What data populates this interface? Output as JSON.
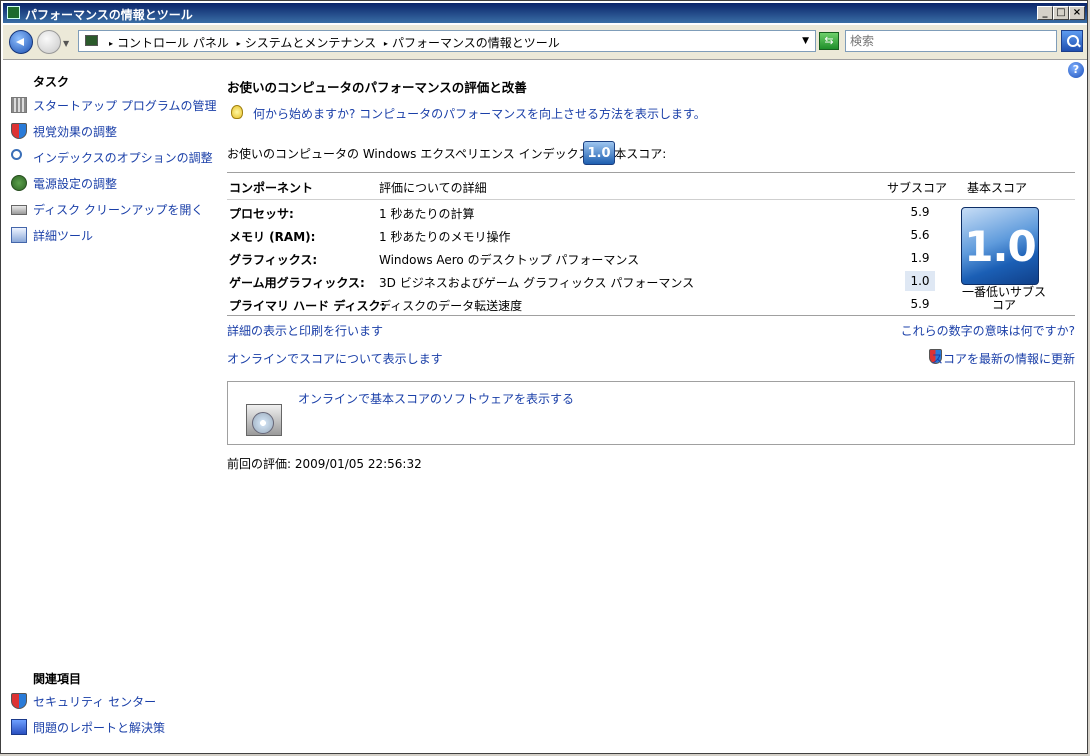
{
  "window": {
    "title": "パフォーマンスの情報とツール"
  },
  "navigation": {
    "breadcrumbs": [
      "コントロール パネル",
      "システムとメンテナンス",
      "パフォーマンスの情報とツール"
    ],
    "search_placeholder": "検索"
  },
  "sidebar": {
    "tasks_heading": "タスク",
    "tasks": [
      {
        "label": "スタートアップ プログラムの管理",
        "icon": "startup-programs-icon"
      },
      {
        "label": "視覚効果の調整",
        "icon": "shield-icon"
      },
      {
        "label": "インデックスのオプションの調整",
        "icon": "indexing-icon"
      },
      {
        "label": "電源設定の調整",
        "icon": "power-icon"
      },
      {
        "label": "ディスク クリーンアップを開く",
        "icon": "disk-cleanup-icon"
      },
      {
        "label": "詳細ツール",
        "icon": "advanced-tools-icon"
      }
    ],
    "related_heading": "関連項目",
    "related": [
      {
        "label": "セキュリティ センター",
        "icon": "shield-icon"
      },
      {
        "label": "問題のレポートと解決策",
        "icon": "problem-reports-icon"
      }
    ]
  },
  "main": {
    "title": "お使いのコンピュータのパフォーマンスの評価と改善",
    "tip_text": "何から始めますか? コンピュータのパフォーマンスを向上させる方法を表示します。",
    "score_line": "お使いのコンピュータの Windows エクスペリエンス インデックスの基本スコア:",
    "base_score": "1.0",
    "table_headers": {
      "component": "コンポーネント",
      "detail": "評価についての詳細",
      "subscore": "サブスコア",
      "basescore": "基本スコア"
    },
    "rows": [
      {
        "component": "プロセッサ:",
        "detail": "1 秒あたりの計算",
        "subscore": "5.9"
      },
      {
        "component": "メモリ (RAM):",
        "detail": "1 秒あたりのメモリ操作",
        "subscore": "5.6"
      },
      {
        "component": "グラフィックス:",
        "detail": "Windows Aero のデスクトップ パフォーマンス",
        "subscore": "1.9"
      },
      {
        "component": "ゲーム用グラフィックス:",
        "detail": "3D ビジネスおよびゲーム グラフィックス パフォーマンス",
        "subscore": "1.0"
      },
      {
        "component": "プライマリ ハード ディスク:",
        "detail": "ディスクのデータ転送速度",
        "subscore": "5.9"
      }
    ],
    "base_score_label": "一番低いサブスコア",
    "link_print": "詳細の表示と印刷を行います",
    "link_meaning": "これらの数字の意味は何ですか?",
    "link_online": "オンラインでスコアについて表示します",
    "link_update": "スコアを最新の情報に更新",
    "software_box_link": "オンラインで基本スコアのソフトウェアを表示する",
    "last_rating": "前回の評価: 2009/01/05 22:56:32"
  }
}
